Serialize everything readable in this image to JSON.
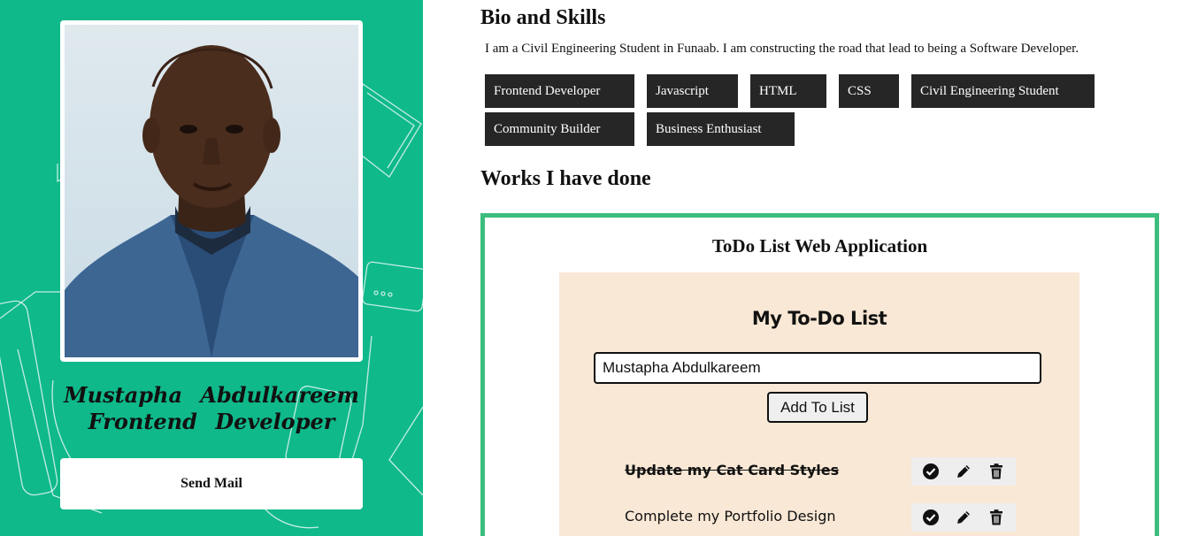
{
  "profile": {
    "name": "Mustapha  Abdulkareem",
    "role": "Frontend  Developer",
    "send_mail_label": "Send Mail",
    "panel_color": "#0fb98a"
  },
  "bio": {
    "title": "Bio and Skills",
    "text": "I am a Civil Engineering Student in Funaab. I am constructing the road that lead to being a Software Developer."
  },
  "skills": [
    "Frontend Developer",
    "Javascript",
    "HTML",
    "CSS",
    "Civil Engineering Student",
    "Community Builder",
    "Business Enthusiast"
  ],
  "works": {
    "title": "Works I have done",
    "border_color": "#3dbd7d",
    "project": {
      "title": "ToDo List Web Application",
      "app": {
        "heading": "My To-Do List",
        "input_value": "Mustapha Abdulkareem",
        "add_button_label": "Add To List",
        "background": "#f9e8d5",
        "tasks": [
          {
            "label": "Update my Cat Card Styles",
            "completed": true,
            "actions": [
              "check-circle-icon",
              "pencil-icon",
              "trash-icon"
            ]
          },
          {
            "label": "Complete my Portfolio Design",
            "completed": false,
            "actions": [
              "check-circle-icon",
              "pencil-icon",
              "trash-icon"
            ]
          }
        ]
      }
    }
  }
}
